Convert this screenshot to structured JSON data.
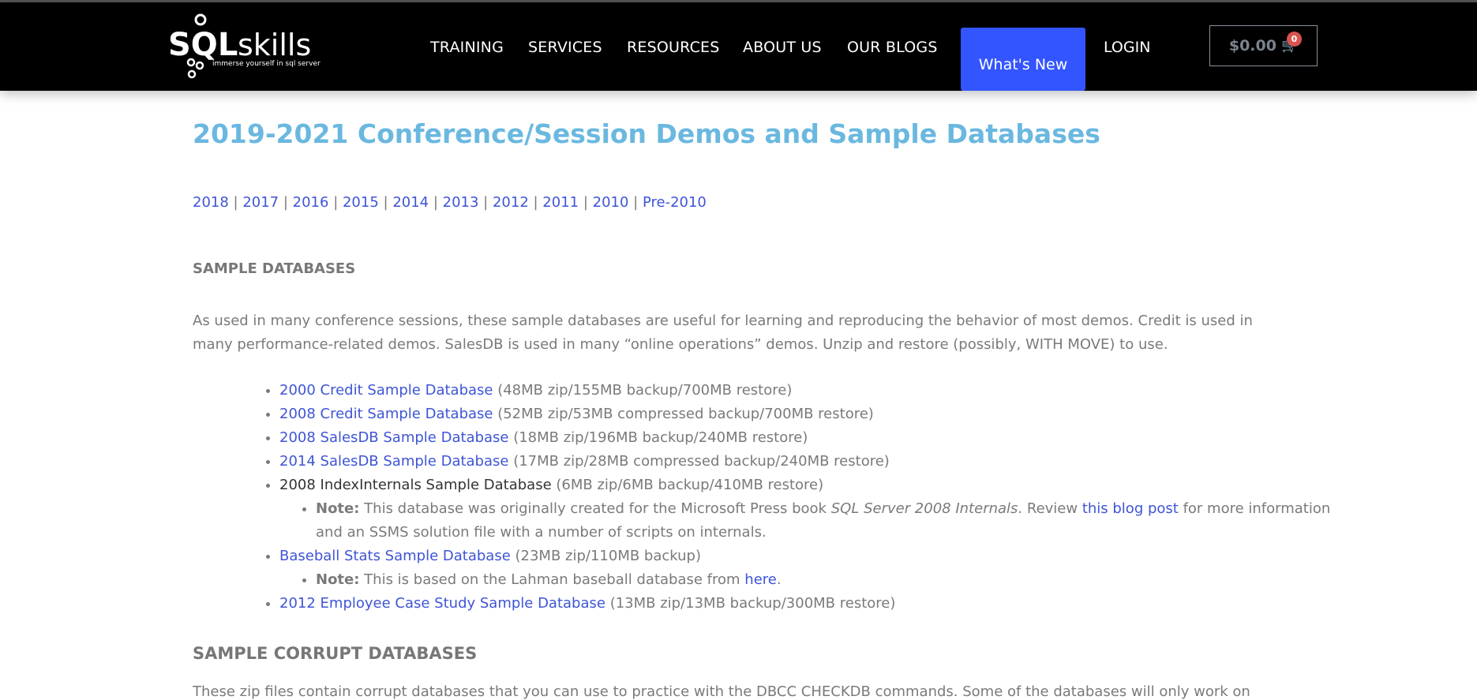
{
  "header": {
    "logo_text": "SQLskills",
    "logo_tagline": "immerse yourself in sql server",
    "nav": [
      "TRAINING",
      "SERVICES",
      "RESOURCES",
      "ABOUT US",
      "OUR BLOGS"
    ],
    "whats_new": "What's New",
    "login": "LOGIN",
    "cart_total": "$0.00",
    "cart_count": "0"
  },
  "title": "2019-2021 Conference/Session Demos and Sample Databases",
  "years": [
    "2018",
    "2017",
    "2016",
    "2015",
    "2014",
    "2013",
    "2012",
    "2011",
    "2010",
    "Pre-2010"
  ],
  "sample_heading": "SAMPLE DATABASES",
  "intro": "As used in many conference sessions, these sample databases are useful for learning and reproducing the behavior of most demos. Credit is used in many performance-related demos. SalesDB is used in many “online operations” demos. Unzip and restore (possibly, WITH MOVE) to use.",
  "items": [
    {
      "link": "2000 Credit Sample Database",
      "info": " (48MB zip/155MB backup/700MB restore)"
    },
    {
      "link": "2008 Credit Sample Database",
      "info": " (52MB zip/53MB compressed backup/700MB restore)"
    },
    {
      "link": "2008 SalesDB Sample Database",
      "info": " (18MB zip/196MB backup/240MB restore)"
    },
    {
      "link": "2014 SalesDB Sample Database",
      "info": " (17MB zip/28MB compressed backup/240MB restore)"
    },
    {
      "text": "2008 IndexInternals Sample Database",
      "info": " (6MB zip/6MB backup/410MB restore)"
    },
    {
      "link": "Baseball Stats Sample Database",
      "info": " (23MB zip/110MB backup)"
    },
    {
      "link": "2012 Employee Case Study Sample Database",
      "info": " (13MB zip/13MB backup/300MB restore)"
    }
  ],
  "note1": {
    "label": "Note:",
    "t1": " This database was originally created for the Microsoft Press book ",
    "book": "SQL Server 2008 Internals",
    "t2": ". Review ",
    "link": "this blog post",
    "t3": " for more information and an SSMS solution file with a number of scripts on internals."
  },
  "note2": {
    "label": "Note:",
    "t1": " This is based on the Lahman baseball database from ",
    "link": "here",
    "t2": "."
  },
  "corrupt_heading": "SAMPLE CORRUPT DATABASES",
  "corrupt_intro": "These zip files contain corrupt databases that you can use to practice with the DBCC CHECKDB commands. Some of the databases will only work on"
}
